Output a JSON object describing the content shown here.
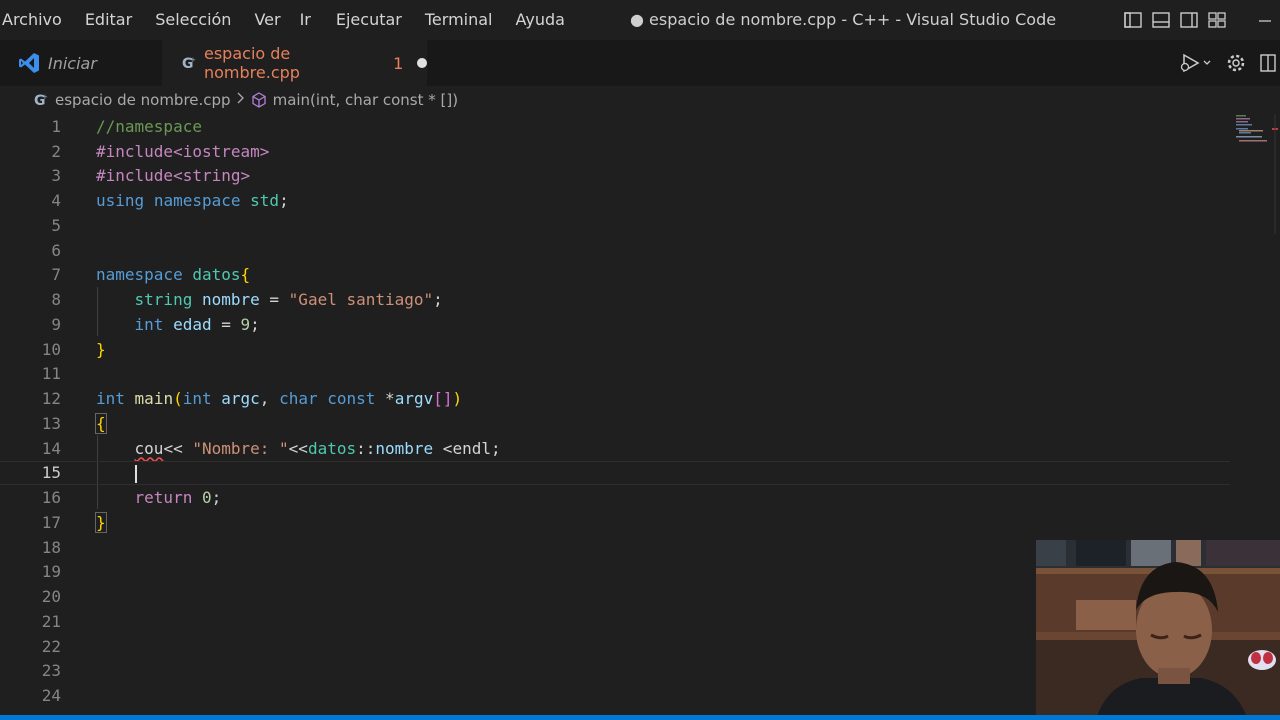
{
  "menu": [
    "Archivo",
    "Editar",
    "Selección",
    "Ver",
    "Ir",
    "Ejecutar",
    "Terminal",
    "Ayuda"
  ],
  "window_title": "● espacio de nombre.cpp - C++ - Visual Studio Code",
  "tabs": {
    "start": {
      "label": "Iniciar"
    },
    "file": {
      "label": "espacio de nombre.cpp",
      "problems": "1"
    }
  },
  "breadcrumb": {
    "file": "espacio de nombre.cpp",
    "symbol": "main(int, char const * [])"
  },
  "icons": {
    "vscode": "vscode-logo-icon",
    "cpp": "cpp-file-icon",
    "symbol": "method-cube-icon",
    "run": "run-debug-icon",
    "settings": "gear-icon"
  },
  "colors": {
    "accent": "#0078d4",
    "background": "#1f1f1f",
    "tab_modified": "#e7805a"
  },
  "current_line": 15,
  "lines": [
    "1",
    "2",
    "3",
    "4",
    "5",
    "6",
    "7",
    "8",
    "9",
    "10",
    "11",
    "12",
    "13",
    "14",
    "15",
    "16",
    "17",
    "18",
    "19",
    "20",
    "21",
    "22",
    "23",
    "24"
  ],
  "code": {
    "l1": "//namespace",
    "l2": "#include<iostream>",
    "l3": "#include<string>",
    "l4_a": "using",
    "l4_b": "namespace",
    "l4_c": "std",
    "l4_d": ";",
    "l7_a": "namespace",
    "l7_b": "datos",
    "l7_c": "{",
    "l8_a": "string",
    "l8_b": "nombre",
    "l8_c": " = ",
    "l8_d": "\"Gael santiago\"",
    "l8_e": ";",
    "l9_a": "int",
    "l9_b": "edad",
    "l9_c": " = ",
    "l9_d": "9",
    "l9_e": ";",
    "l10": "}",
    "l12_a": "int",
    "l12_b": "main",
    "l12_c": "(",
    "l12_d": "int",
    "l12_e": "argc",
    "l12_f": ", ",
    "l12_g": "char",
    "l12_h": "const",
    "l12_i": "*",
    "l12_j": "argv",
    "l12_k": "[]",
    "l12_l": ")",
    "l13": "{",
    "l14_a": "cou",
    "l14_b": "<< ",
    "l14_c": "\"Nombre: \"",
    "l14_d": "<<",
    "l14_e": "datos",
    "l14_f": "::",
    "l14_g": "nombre",
    "l14_h": " <",
    "l14_i": "endl",
    "l14_j": ";",
    "l16_a": "return",
    "l16_b": "0",
    "l16_c": ";",
    "l17": "}"
  }
}
